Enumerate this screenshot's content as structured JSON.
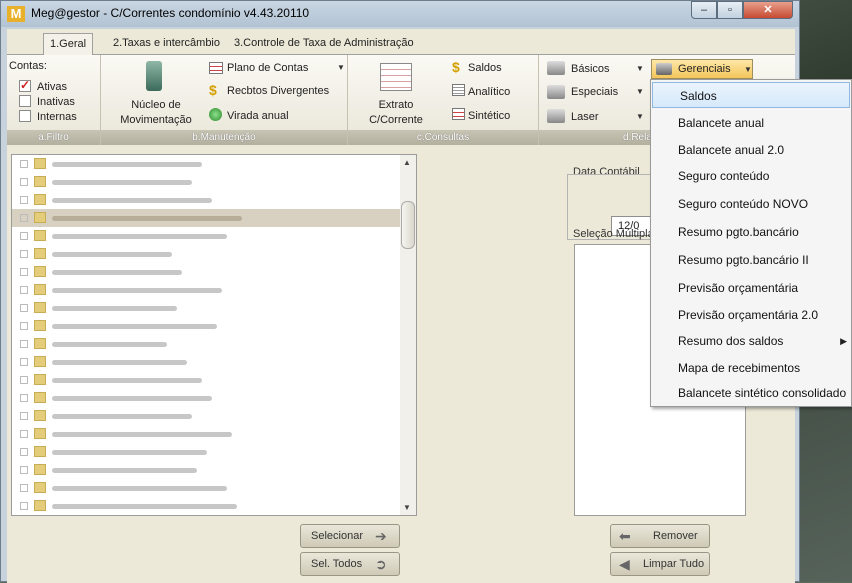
{
  "window": {
    "title": "Meg@gestor - C/Correntes condomínio v4.43.20110",
    "logo": "M"
  },
  "tabs": [
    "1.Geral",
    "2.Taxas e intercâmbio",
    "3.Controle de Taxa de Administração"
  ],
  "filter": {
    "caption": "a.Filtro",
    "label": "Contas:",
    "options": [
      {
        "label": "Ativas",
        "checked": true
      },
      {
        "label": "Inativas",
        "checked": false
      },
      {
        "label": "Internas",
        "checked": false
      }
    ]
  },
  "maintenance": {
    "caption": "b.Manutenção",
    "big_label_1": "Núcleo de",
    "big_label_2": "Movimentação",
    "items": [
      "Plano de Contas",
      "Recbtos Divergentes",
      "Virada anual"
    ]
  },
  "consultas": {
    "caption": "c.Consultas",
    "big_label_1": "Extrato",
    "big_label_2": "C/Corrente",
    "items": [
      "Saldos",
      "Analítico",
      "Sintético"
    ]
  },
  "relatorios": {
    "caption": "d.Relat",
    "items": [
      "Básicos",
      "Especiais",
      "Laser"
    ],
    "gerenciais": "Gerenciais"
  },
  "right_panel": {
    "data_contabil_label": "Data Contábil",
    "data_contabil_value": "12/0",
    "selecao_label": "Seleção Múltipla"
  },
  "buttons": {
    "selecionar": "Selecionar",
    "sel_todos": "Sel. Todos",
    "remover": "Remover",
    "limpar_tudo": "Limpar Tudo"
  },
  "menu": {
    "items": [
      {
        "label": "Saldos",
        "highlighted": true
      },
      {
        "label": "Balancete anual"
      },
      {
        "label": "Balancete anual 2.0"
      },
      {
        "label": "Seguro conteúdo"
      },
      {
        "label": "Seguro conteúdo NOVO"
      },
      {
        "label": "Resumo pgto.bancário"
      },
      {
        "label": "Resumo pgto.bancário II"
      },
      {
        "label": "Previsão orçamentária"
      },
      {
        "label": "Previsão orçamentária 2.0"
      },
      {
        "label": "Resumo dos saldos",
        "submenu": true
      },
      {
        "label": "Mapa de recebimentos"
      },
      {
        "label": "Balancete sintético consolidado"
      }
    ]
  },
  "colors": {
    "accent": "#e9b02c",
    "menu_highlight": "#d6e9fb",
    "selected_row": "#d8d0c0"
  }
}
